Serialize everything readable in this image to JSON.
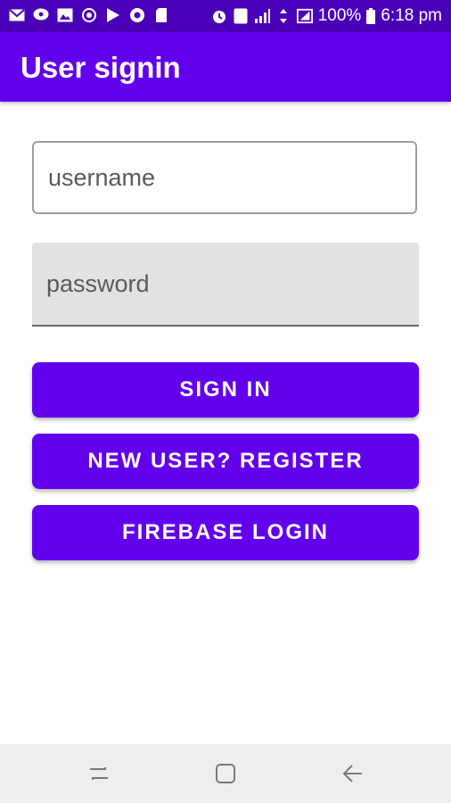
{
  "status_bar": {
    "left_icons": [
      "mail-icon",
      "chat-bubble-icon",
      "image-icon",
      "sync-icon",
      "play-store-icon",
      "chrome-icon",
      "sd-card-icon"
    ],
    "right_icons": [
      "alarm-icon",
      "sim-2-icon",
      "signal-icon",
      "data-icon",
      "signal-box-icon",
      "battery-icon"
    ],
    "sim_badge": "2",
    "battery": "100%",
    "time": "6:18 pm"
  },
  "app_bar": {
    "title": "User signin"
  },
  "form": {
    "username": {
      "placeholder": "username",
      "value": ""
    },
    "password": {
      "placeholder": "password",
      "value": ""
    }
  },
  "buttons": {
    "sign_in": "SIGN IN",
    "register": "NEW USER? REGISTER",
    "firebase_login": "FIREBASE LOGIN"
  },
  "nav_bar": {
    "icons": [
      "recent-apps-icon",
      "home-icon",
      "back-icon"
    ]
  },
  "colors": {
    "status_bar": "#4a00b8",
    "primary": "#6200ee",
    "field_fill": "#e2e2e2",
    "nav_bar": "#eeeeee"
  }
}
